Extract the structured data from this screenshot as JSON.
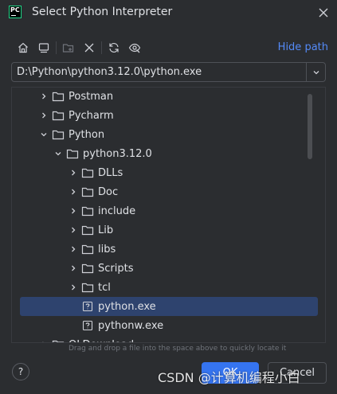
{
  "window": {
    "app_icon": "pycharm-logo",
    "logo_text": "PC",
    "title": "Select Python Interpreter"
  },
  "toolbar": {
    "buttons": [
      "home-icon",
      "desktop-icon",
      "new-folder-icon",
      "delete-icon",
      "refresh-icon",
      "show-hidden-icon"
    ],
    "hide_path_label": "Hide path"
  },
  "path": {
    "value": "D:\\Python\\python3.12.0\\python.exe"
  },
  "tree": {
    "items": [
      {
        "label": "Postman",
        "type": "folder",
        "expanded": false,
        "level": 1
      },
      {
        "label": "Pycharm",
        "type": "folder",
        "expanded": false,
        "level": 1
      },
      {
        "label": "Python",
        "type": "folder",
        "expanded": true,
        "level": 1
      },
      {
        "label": "python3.12.0",
        "type": "folder",
        "expanded": true,
        "level": 2
      },
      {
        "label": "DLLs",
        "type": "folder",
        "expanded": false,
        "level": 3
      },
      {
        "label": "Doc",
        "type": "folder",
        "expanded": false,
        "level": 3
      },
      {
        "label": "include",
        "type": "folder",
        "expanded": false,
        "level": 3
      },
      {
        "label": "Lib",
        "type": "folder",
        "expanded": false,
        "level": 3
      },
      {
        "label": "libs",
        "type": "folder",
        "expanded": false,
        "level": 3
      },
      {
        "label": "Scripts",
        "type": "folder",
        "expanded": false,
        "level": 3
      },
      {
        "label": "tcl",
        "type": "folder",
        "expanded": false,
        "level": 3
      },
      {
        "label": "python.exe",
        "type": "file",
        "selected": true,
        "level": 3
      },
      {
        "label": "pythonw.exe",
        "type": "file",
        "level": 3
      },
      {
        "label": "QLDownload",
        "type": "folder",
        "expanded": false,
        "level": 1
      }
    ]
  },
  "drop_hint": "Drag and drop a file into the space above to quickly locate it",
  "buttons": {
    "help": "?",
    "ok": "OK",
    "cancel": "Cancel"
  },
  "watermark": "CSDN @计算机编程小白",
  "colors": {
    "background": "#2b2d30",
    "accent": "#3574f0",
    "selection": "#2e436e",
    "link": "#548af7"
  }
}
